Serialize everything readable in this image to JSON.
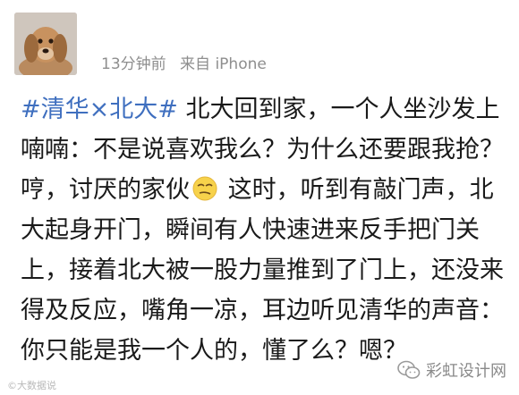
{
  "post": {
    "time": "13分钟前",
    "source_prefix": "来自",
    "source": "iPhone",
    "topic": "#清华×北大#",
    "text_part1": " 北大回到家，一个人坐沙发上喃喃：不是说喜欢我么？为什么还要跟我抢？哼，讨厌的家伙",
    "text_part2": " 这时，听到有敲门声，北大起身开门，瞬间有人快速进来反手把门关上，接着北大被一股力量推到了门上，还没来得及反应，嘴角一凉，耳边听见清华的声音：你只能是我一个人的，懂了么？嗯？"
  },
  "icons": {
    "avatar": "dog-avatar",
    "emoji": "sneer-emoji",
    "watermark_logo": "wechat-logo-icon"
  },
  "watermarks": {
    "left": "©大数据说",
    "right": "彩虹设计网"
  },
  "colors": {
    "topic": "#3f6fbf",
    "meta": "#8e8e8e",
    "text": "#1a1a1a"
  }
}
